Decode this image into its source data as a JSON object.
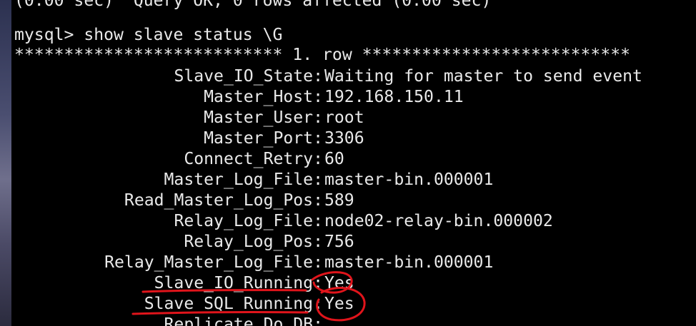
{
  "terminal": {
    "previous_output": "(0.00 sec)  Query OK, 0 rows affected (0.00 sec)",
    "prompt": "mysql>",
    "command": "show slave status \\G",
    "row_separator": "*************************** 1. row ***************************",
    "fields": [
      {
        "name": "Slave_IO_State",
        "value": "Waiting for master to send event"
      },
      {
        "name": "Master_Host",
        "value": "192.168.150.11"
      },
      {
        "name": "Master_User",
        "value": "root"
      },
      {
        "name": "Master_Port",
        "value": "3306"
      },
      {
        "name": "Connect_Retry",
        "value": "60"
      },
      {
        "name": "Master_Log_File",
        "value": "master-bin.000001"
      },
      {
        "name": "Read_Master_Log_Pos",
        "value": "589"
      },
      {
        "name": "Relay_Log_File",
        "value": "node02-relay-bin.000002"
      },
      {
        "name": "Relay_Log_Pos",
        "value": "756"
      },
      {
        "name": "Relay_Master_Log_File",
        "value": "master-bin.000001"
      },
      {
        "name": "Slave_IO_Running",
        "value": "Yes"
      },
      {
        "name": "Slave_SQL_Running",
        "value": "Yes"
      },
      {
        "name": "Replicate_Do_DB",
        "value": ""
      }
    ]
  },
  "colors": {
    "background": "#000000",
    "text": "#e9e9e9",
    "annotation": "#e0141b"
  }
}
